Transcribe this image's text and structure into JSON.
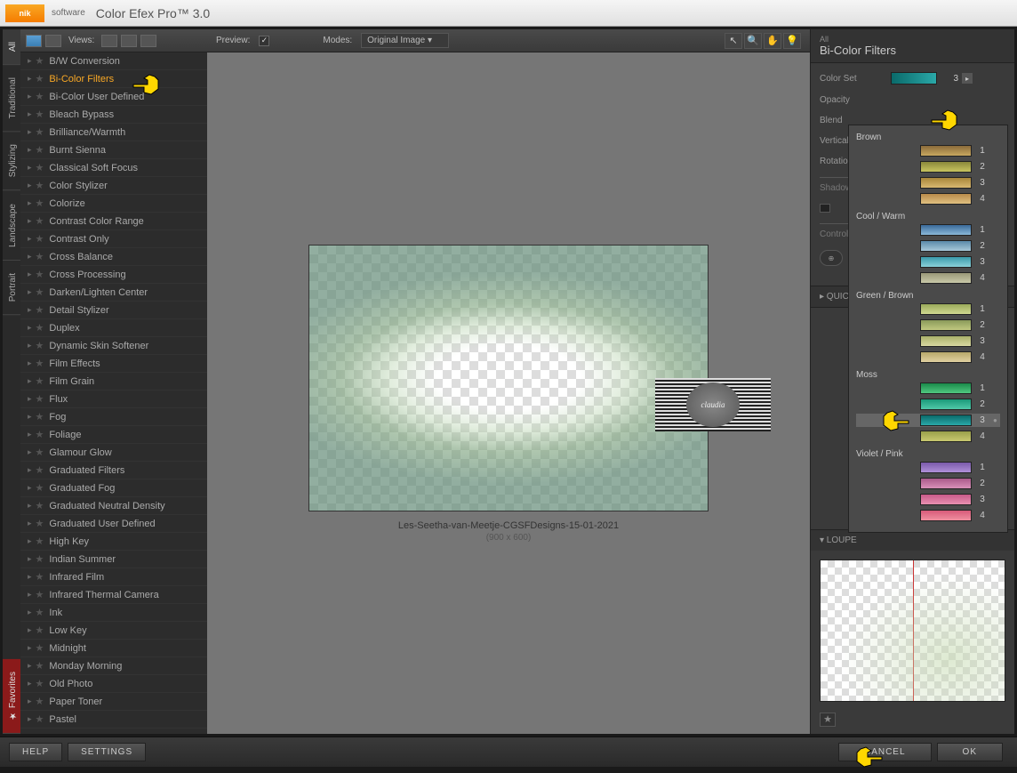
{
  "app": {
    "brand": "software",
    "title": "Color Efex Pro™ 3.0"
  },
  "leftTabs": [
    "All",
    "Traditional",
    "Stylizing",
    "Landscape",
    "Portrait",
    "Favorites"
  ],
  "toolbar": {
    "views": "Views:",
    "preview": "Preview:",
    "modes": "Modes:",
    "modeValue": "Original Image"
  },
  "filters": [
    "B/W Conversion",
    "Bi-Color Filters",
    "Bi-Color User Defined",
    "Bleach Bypass",
    "Brilliance/Warmth",
    "Burnt Sienna",
    "Classical Soft Focus",
    "Color Stylizer",
    "Colorize",
    "Contrast Color Range",
    "Contrast Only",
    "Cross Balance",
    "Cross Processing",
    "Darken/Lighten Center",
    "Detail Stylizer",
    "Duplex",
    "Dynamic Skin Softener",
    "Film Effects",
    "Film Grain",
    "Flux",
    "Fog",
    "Foliage",
    "Glamour Glow",
    "Graduated Filters",
    "Graduated Fog",
    "Graduated Neutral Density",
    "Graduated User Defined",
    "High Key",
    "Indian Summer",
    "Infrared Film",
    "Infrared Thermal Camera",
    "Ink",
    "Low Key",
    "Midnight",
    "Monday Morning",
    "Old Photo",
    "Paper Toner",
    "Pastel"
  ],
  "selectedFilterIndex": 1,
  "preview": {
    "caption": "Les-Seetha-van-Meetje-CGSFDesigns-15-01-2021",
    "dimensions": "(900 x 600)",
    "watermark": "claudia"
  },
  "rightPanel": {
    "category": "All",
    "title": "Bi-Color Filters",
    "params": {
      "colorSet": {
        "label": "Color Set",
        "value": "3"
      },
      "opacity": "Opacity",
      "blend": "Blend",
      "verticalShift": "Vertical Shift",
      "rotation": "Rotation",
      "shadows": "Shadows / Highli",
      "controlPoints": "Control Points"
    },
    "quickSave": "▸ QUICK SAVE",
    "loupe": "▾ LOUPE"
  },
  "colorSetPopup": {
    "groups": [
      {
        "name": "Brown",
        "swatches": [
          {
            "n": "1",
            "g": "linear-gradient(#8a6a3a,#c8a860)"
          },
          {
            "n": "2",
            "g": "linear-gradient(#8a883a,#c8c460)"
          },
          {
            "n": "3",
            "g": "linear-gradient(#a8863a,#d8b870)"
          },
          {
            "n": "4",
            "g": "linear-gradient(#b88a4a,#e0c080)"
          }
        ]
      },
      {
        "name": "Cool / Warm",
        "swatches": [
          {
            "n": "1",
            "g": "linear-gradient(#3a6a9a,#8ab8d8)"
          },
          {
            "n": "2",
            "g": "linear-gradient(#5a8aaa,#a8c8d8)"
          },
          {
            "n": "3",
            "g": "linear-gradient(#3a9aaa,#8ad0d8)"
          },
          {
            "n": "4",
            "g": "linear-gradient(#9a9878,#c8c8a8)"
          }
        ]
      },
      {
        "name": "Green / Brown",
        "swatches": [
          {
            "n": "1",
            "g": "linear-gradient(#9aaa5a,#d0d890)"
          },
          {
            "n": "2",
            "g": "linear-gradient(#8a9a5a,#c0c880)"
          },
          {
            "n": "3",
            "g": "linear-gradient(#aab06a,#d8d8a0)"
          },
          {
            "n": "4",
            "g": "linear-gradient(#b8a86a,#e0d0a0)"
          }
        ]
      },
      {
        "name": "Moss",
        "swatches": [
          {
            "n": "1",
            "g": "linear-gradient(#1a8a4a,#50c880)"
          },
          {
            "n": "2",
            "g": "linear-gradient(#1a9a7a,#50c8a8)"
          },
          {
            "n": "3",
            "g": "linear-gradient(#0a6a6a,#2aa8a8)",
            "sel": true
          },
          {
            "n": "4",
            "g": "linear-gradient(#9aa04a,#c8c870)"
          }
        ]
      },
      {
        "name": "Violet / Pink",
        "swatches": [
          {
            "n": "1",
            "g": "linear-gradient(#7a5aaa,#b090d8)"
          },
          {
            "n": "2",
            "g": "linear-gradient(#aa5a8a,#d890b8)"
          },
          {
            "n": "3",
            "g": "linear-gradient(#c85a8a,#e890b0)"
          },
          {
            "n": "4",
            "g": "linear-gradient(#d85a7a,#f090a0)"
          }
        ]
      }
    ]
  },
  "bottom": {
    "help": "HELP",
    "settings": "SETTINGS",
    "cancel": "CANCEL",
    "ok": "OK"
  }
}
